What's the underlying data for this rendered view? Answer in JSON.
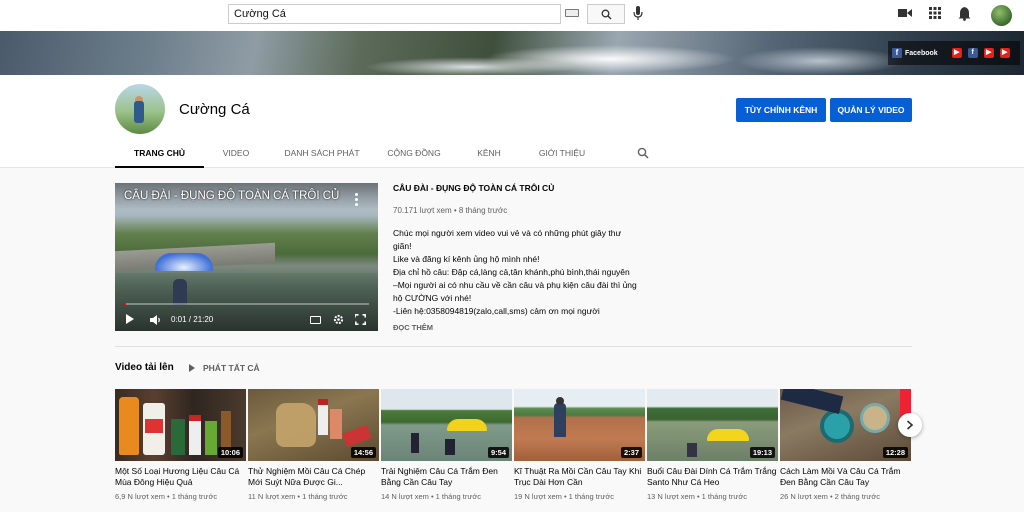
{
  "search": {
    "query": "Cường Cá"
  },
  "banner": {
    "facebook_label": "Facebook"
  },
  "channel": {
    "name": "Cường Cá",
    "customize_label": "TÙY CHỈNH KÊNH",
    "manage_label": "QUẢN LÝ VIDEO"
  },
  "tabs": [
    {
      "label": "TRANG CHỦ",
      "active": true
    },
    {
      "label": "VIDEO"
    },
    {
      "label": "DANH SÁCH PHÁT"
    },
    {
      "label": "CỘNG ĐỒNG"
    },
    {
      "label": "KÊNH"
    },
    {
      "label": "GIỚI THIỆU"
    }
  ],
  "featured": {
    "overlay_title": "CÂU ĐÀI - ĐỤNG ĐỘ TOÀN CÁ TRÔI CỦ",
    "title": "CÂU ĐÀI - ĐỤNG ĐỘ TOÀN CÁ TRÔI CỦ",
    "meta": "70.171 lượt xem • 8 tháng trước",
    "time": "0:01 / 21:20",
    "progress": 0.01,
    "desc": [
      "Chúc mọi người xem video vui vẻ và có những phút giây thư",
      "giãn!",
      "Like và đăng kí kênh ủng hộ mình nhé!",
      "Địa chỉ hồ câu: Đập cá,làng cả,tân khánh,phú bình,thái nguyên",
      "–Mọi người ai có nhu cầu về cần câu và phụ kiện câu đài thì ủng",
      "hộ CƯỜNG với nhé!",
      "-Liên hệ:0358094819(zalo,call,sms) cảm ơn mọi người"
    ],
    "read_more": "ĐỌC THÊM"
  },
  "uploads": {
    "title": "Video tải lên",
    "play_all": "PHÁT TẤT CẢ",
    "videos": [
      {
        "title": "Một Số Loại Hương Liệu Câu Cá Mùa Đông Hiệu Quả",
        "meta": "6,9 N lượt xem • 1 tháng trước",
        "duration": "10:06"
      },
      {
        "title": "Thử Nghiệm Mồi Câu Cá Chép Mới Suýt Nữa Được Gi...",
        "meta": "11 N lượt xem • 1 tháng trước",
        "duration": "14:56"
      },
      {
        "title": "Trải Nghiệm Câu Cá Trắm Đen Bằng Cần Câu Tay",
        "meta": "14 N lượt xem • 1 tháng trước",
        "duration": "9:54"
      },
      {
        "title": "Kĩ Thuật Ra Mồi Cần Câu Tay Khi Trục Dài Hơn Cần",
        "meta": "19 N lượt xem • 1 tháng trước",
        "duration": "2:37"
      },
      {
        "title": "Buổi Câu Đài Dính Cá Trắm Trắng Santo Như Cá Heo",
        "meta": "13 N lượt xem • 1 tháng trước",
        "duration": "19:13"
      },
      {
        "title": "Cách Làm Mồi Và Câu Cá Trắm Đen Bằng Cần Câu Tay",
        "meta": "26 N lượt xem • 2 tháng trước",
        "duration": "12:28"
      }
    ]
  }
}
